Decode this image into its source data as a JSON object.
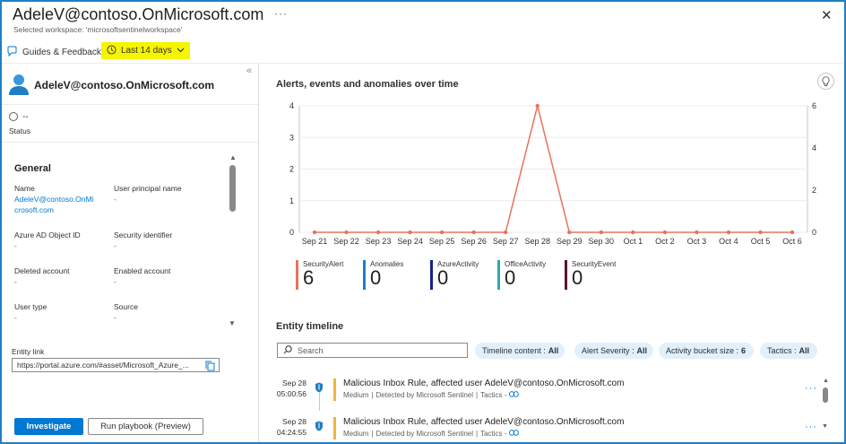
{
  "header": {
    "title": "AdeleV@contoso.OnMicrosoft.com",
    "more": "···",
    "close": "✕",
    "subtitle": "Selected workspace: 'microsoftsentinelworkspace'"
  },
  "toolbar": {
    "guides_label": "Guides & Feedback",
    "time_range_label": "Last 14 days"
  },
  "entity": {
    "name": "AdeleV@contoso.OnMicrosoft.com",
    "collapse": "«",
    "status_value": "--",
    "status_label": "Status"
  },
  "general": {
    "heading": "General",
    "props": [
      {
        "label": "Name",
        "value": "AdeleV@contoso.OnMicrosoft.com"
      },
      {
        "label": "User principal name",
        "value": "-"
      },
      {
        "label": "Azure AD Object ID",
        "value": "-"
      },
      {
        "label": "Security identifier",
        "value": "-"
      },
      {
        "label": "Deleted account",
        "value": "-"
      },
      {
        "label": "Enabled account",
        "value": "-"
      },
      {
        "label": "User type",
        "value": "-"
      },
      {
        "label": "Source",
        "value": "-"
      }
    ],
    "name_line1": "AdeleV@contoso.OnMi",
    "name_line2": "crosoft.com"
  },
  "entity_link": {
    "label": "Entity link",
    "value": "https://portal.azure.com/#asset/Microsoft_Azure_..."
  },
  "actions": {
    "investigate": "Investigate",
    "run_playbook": "Run playbook (Preview)"
  },
  "chart_section": {
    "title": "Alerts, events and anomalies over time"
  },
  "chart_data": {
    "type": "line",
    "categories": [
      "Sep 21",
      "Sep 22",
      "Sep 23",
      "Sep 24",
      "Sep 25",
      "Sep 26",
      "Sep 27",
      "Sep 28",
      "Sep 29",
      "Sep 30",
      "Oct 1",
      "Oct 2",
      "Oct 3",
      "Oct 4",
      "Oct 5",
      "Oct 6"
    ],
    "series": [
      {
        "name": "SecurityAlert",
        "color": "#e8735a",
        "values": [
          0,
          0,
          0,
          0,
          0,
          0,
          0,
          4,
          0,
          0,
          0,
          0,
          0,
          0,
          0,
          0
        ]
      }
    ],
    "y_left": {
      "ticks": [
        0,
        1,
        2,
        3,
        4
      ],
      "range": [
        0,
        4
      ]
    },
    "y_right": {
      "ticks": [
        0,
        2,
        4,
        6
      ],
      "range": [
        0,
        6
      ]
    },
    "grid": true
  },
  "legend": [
    {
      "name": "SecurityAlert",
      "count": "6",
      "color": "#e8735a"
    },
    {
      "name": "Anomalies",
      "count": "0",
      "color": "#1f7fc4"
    },
    {
      "name": "AzureActivity",
      "count": "0",
      "color": "#1b1f8a"
    },
    {
      "name": "OfficeActivity",
      "count": "0",
      "color": "#2aa9b3"
    },
    {
      "name": "SecurityEvent",
      "count": "0",
      "color": "#5c1330"
    }
  ],
  "timeline": {
    "title": "Entity timeline",
    "search_placeholder": "Search",
    "filters": [
      {
        "label": "Timeline content :",
        "value": "All"
      },
      {
        "label": "Alert Severity :",
        "value": "All"
      },
      {
        "label": "Activity bucket size :",
        "value": "6"
      },
      {
        "label": "Tactics :",
        "value": "All"
      }
    ],
    "items": [
      {
        "date": "Sep 28",
        "time": "05:00:56",
        "title": "Malicious Inbox Rule, affected user AdeleV@contoso.OnMicrosoft.com",
        "severity": "Medium",
        "detected": "Detected by Microsoft Sentinel",
        "tactics": "Tactics -"
      },
      {
        "date": "Sep 28",
        "time": "04:24:55",
        "title": "Malicious Inbox Rule, affected user AdeleV@contoso.OnMicrosoft.com",
        "severity": "Medium",
        "detected": "Detected by Microsoft Sentinel",
        "tactics": "Tactics -"
      }
    ],
    "more": "···"
  }
}
